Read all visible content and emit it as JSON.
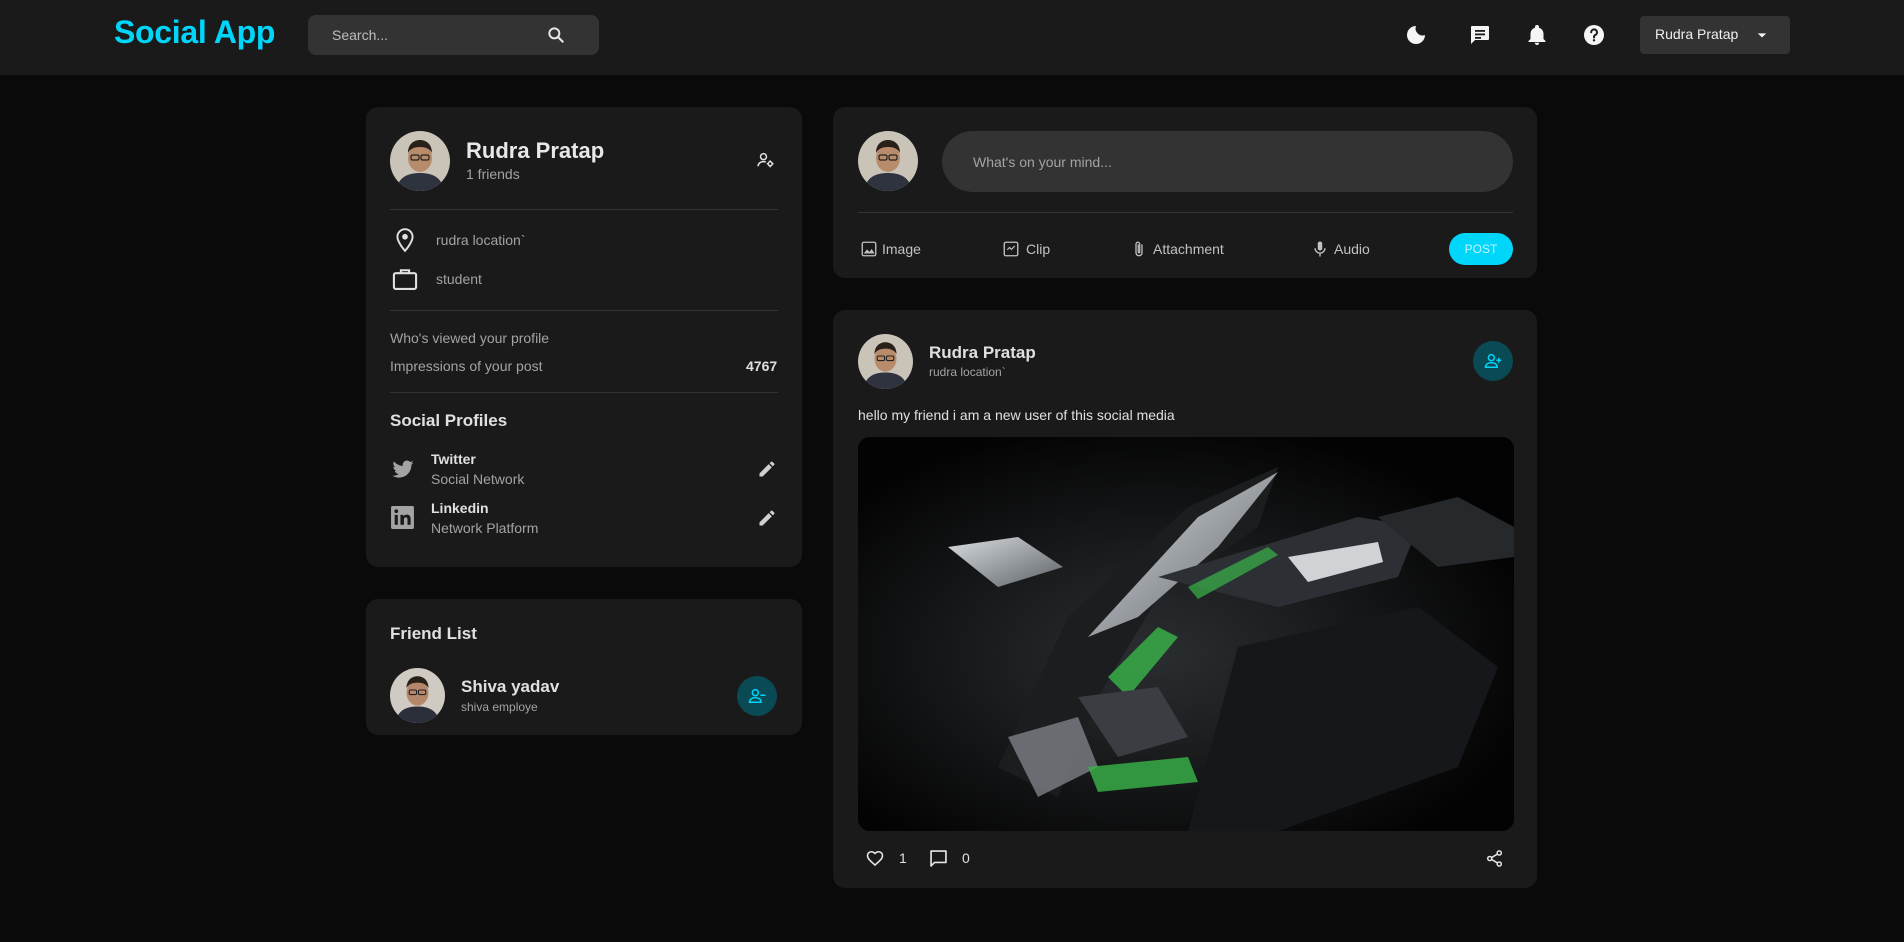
{
  "navbar": {
    "logo": "Social App",
    "search_placeholder": "Search...",
    "user_select": "Rudra Pratap"
  },
  "profile_widget": {
    "name": "Rudra Pratap",
    "friends": "1 friends",
    "location": "rudra location`",
    "occupation": "student",
    "viewed_label": "Who's viewed your profile",
    "impressions_label": "Impressions of your post",
    "impressions_value": "4767",
    "social_title": "Social Profiles",
    "socials": [
      {
        "name": "Twitter",
        "sub": "Social Network"
      },
      {
        "name": "Linkedin",
        "sub": "Network Platform"
      }
    ]
  },
  "friend_list": {
    "title": "Friend List",
    "friends": [
      {
        "name": "Shiva yadav",
        "sub": "shiva employe"
      }
    ]
  },
  "composer": {
    "placeholder": "What's on your mind...",
    "options": [
      "Image",
      "Clip",
      "Attachment",
      "Audio"
    ],
    "post_label": "POST"
  },
  "post": {
    "author": "Rudra Pratap",
    "location": "rudra location`",
    "text": "hello my friend i am a new user of this social media",
    "likes": "1",
    "comments": "0"
  },
  "colors": {
    "accent": "#00d5fa",
    "background": "#0a0a0a",
    "panel": "#1a1a1a",
    "input": "#333333"
  }
}
